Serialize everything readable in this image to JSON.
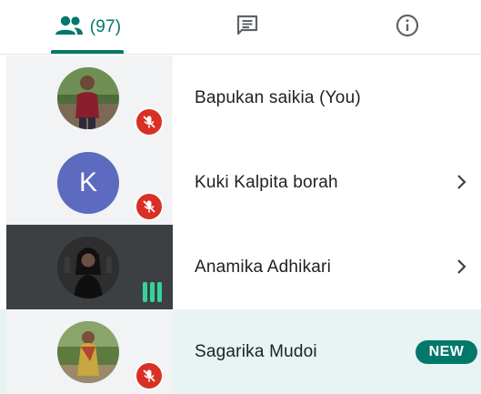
{
  "tabs": {
    "people_count": "(97)",
    "people_icon": "people-icon",
    "chat_icon": "chat-icon",
    "info_icon": "info-icon",
    "accent_color": "#00796b"
  },
  "participants": [
    {
      "name": "Bapukan saikia (You)",
      "avatar": "photo",
      "status": "muted"
    },
    {
      "name": "Kuki Kalpita borah",
      "avatar_letter": "K",
      "status": "muted",
      "has_chevron": true
    },
    {
      "name": "Anamika Adhikari",
      "avatar": "photo",
      "status": "speaking",
      "has_chevron": true
    },
    {
      "name": "Sagarika Mudoi",
      "avatar": "photo",
      "status": "muted",
      "badge": "NEW"
    }
  ],
  "colors": {
    "mute_red": "#d93025",
    "speaking_green": "#34d399",
    "letter_avatar": "#5c6bc0",
    "highlight_row": "#e8f4f3"
  }
}
